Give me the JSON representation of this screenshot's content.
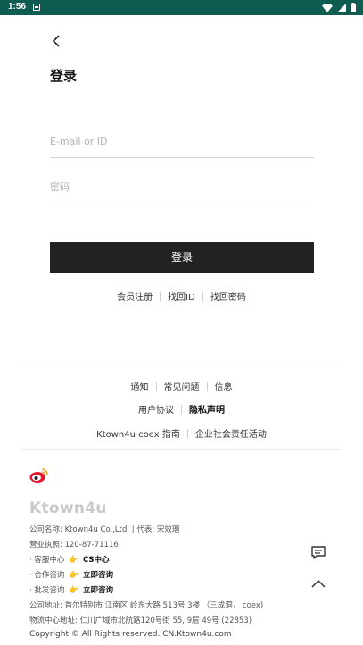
{
  "status_bar": {
    "time": "1:56"
  },
  "header": {
    "title": "登录"
  },
  "form": {
    "email_placeholder": "E-mail or ID",
    "password_placeholder": "密码",
    "login_label": "登录"
  },
  "account_links": [
    "会员注册",
    "找回ID",
    "找回密码"
  ],
  "footer": {
    "row1": [
      "通知",
      "常见问题",
      "信息"
    ],
    "row2": [
      "用户协议",
      "隐私声明"
    ],
    "row3": [
      "Ktown4u coex 指南",
      "企业社会责任活动"
    ],
    "brand": "Ktown4u",
    "company_line": "公司名称: Ktown4u Co.,Ltd.  |  代表: 宋效瑉",
    "license_line": "营业执照: 120-87-71116",
    "cs_prefix": "· 客服中心",
    "cs_link": "CS中心",
    "coop_prefix": "· 合作咨询",
    "coop_link": "立即咨询",
    "wholesale_prefix": "· 批发咨询",
    "wholesale_link": "立即咨询",
    "address_line": "公司地址: 首尔特别市 江南区 岭东大路 513号 3楼 （三成洞， coex)",
    "logistics_line": "物流中心地址: 仁川广域市北航路120号街 55, 9层 49号 (22853)",
    "copyright": "Copyright © All Rights reserved. CN.Ktown4u.com"
  },
  "icons": {
    "back": "chevron-left-icon",
    "chat": "chat-icon",
    "scroll_top": "chevron-up-icon",
    "weibo": "weibo-icon",
    "pointing": "👉"
  },
  "colors": {
    "status_bar": "#0e5b52",
    "button": "#222222"
  }
}
